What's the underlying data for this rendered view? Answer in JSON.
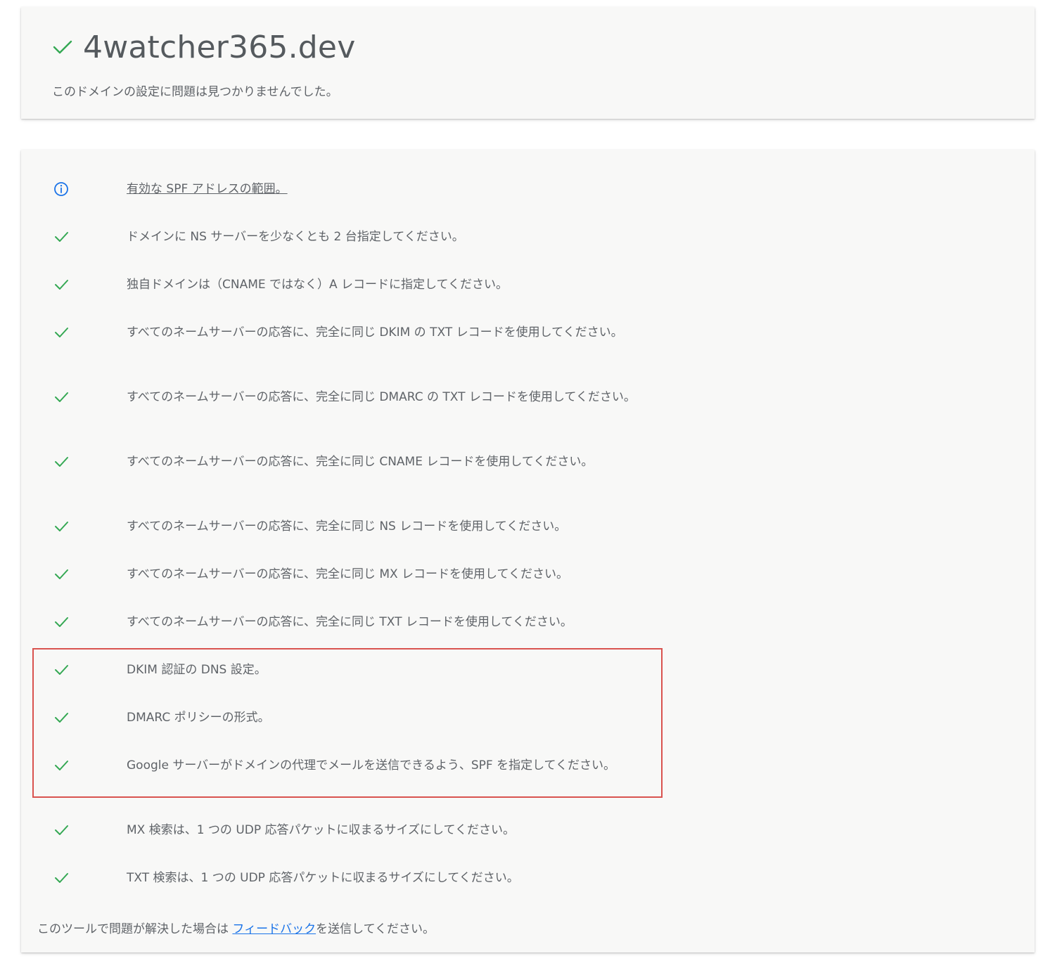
{
  "header": {
    "domain": "4watcher365.dev",
    "summary": "このドメインの設定に問題は見つかりませんでした。"
  },
  "colors": {
    "check": "#34a853",
    "info": "#1a73e8",
    "highlight_border": "#d9534f",
    "link": "#1a73e8"
  },
  "checks": [
    {
      "status": "info",
      "icon": "info-icon",
      "text": "有効な SPF アドレスの範囲。"
    },
    {
      "status": "pass",
      "icon": "check-icon",
      "text": "ドメインに NS サーバーを少なくとも 2 台指定してください。"
    },
    {
      "status": "pass",
      "icon": "check-icon",
      "text": "独自ドメインは（CNAME ではなく）A レコードに指定してください。"
    },
    {
      "status": "pass",
      "icon": "check-icon",
      "text": "すべてのネームサーバーの応答に、完全に同じ DKIM の TXT レコードを使用してください。"
    },
    {
      "status": "pass",
      "icon": "check-icon",
      "text": "すべてのネームサーバーの応答に、完全に同じ DMARC の TXT レコードを使用してください。"
    },
    {
      "status": "pass",
      "icon": "check-icon",
      "text": "すべてのネームサーバーの応答に、完全に同じ CNAME レコードを使用してください。"
    },
    {
      "status": "pass",
      "icon": "check-icon",
      "text": "すべてのネームサーバーの応答に、完全に同じ NS レコードを使用してください。"
    },
    {
      "status": "pass",
      "icon": "check-icon",
      "text": "すべてのネームサーバーの応答に、完全に同じ MX レコードを使用してください。"
    },
    {
      "status": "pass",
      "icon": "check-icon",
      "text": "すべてのネームサーバーの応答に、完全に同じ TXT レコードを使用してください。"
    },
    {
      "status": "pass",
      "icon": "check-icon",
      "text": "DKIM 認証の DNS 設定。"
    },
    {
      "status": "pass",
      "icon": "check-icon",
      "text": "DMARC ポリシーの形式。"
    },
    {
      "status": "pass",
      "icon": "check-icon",
      "text": "Google サーバーがドメインの代理でメールを送信できるよう、SPF を指定してください。"
    },
    {
      "status": "pass",
      "icon": "check-icon",
      "text": "MX 検索は、1 つの UDP 応答パケットに収まるサイズにしてください。"
    },
    {
      "status": "pass",
      "icon": "check-icon",
      "text": "TXT 検索は、1 つの UDP 応答パケットに収まるサイズにしてください。"
    }
  ],
  "footer": {
    "prefix": "このツールで問題が解決した場合は ",
    "link": "フィードバック",
    "suffix": "を送信してください。"
  }
}
